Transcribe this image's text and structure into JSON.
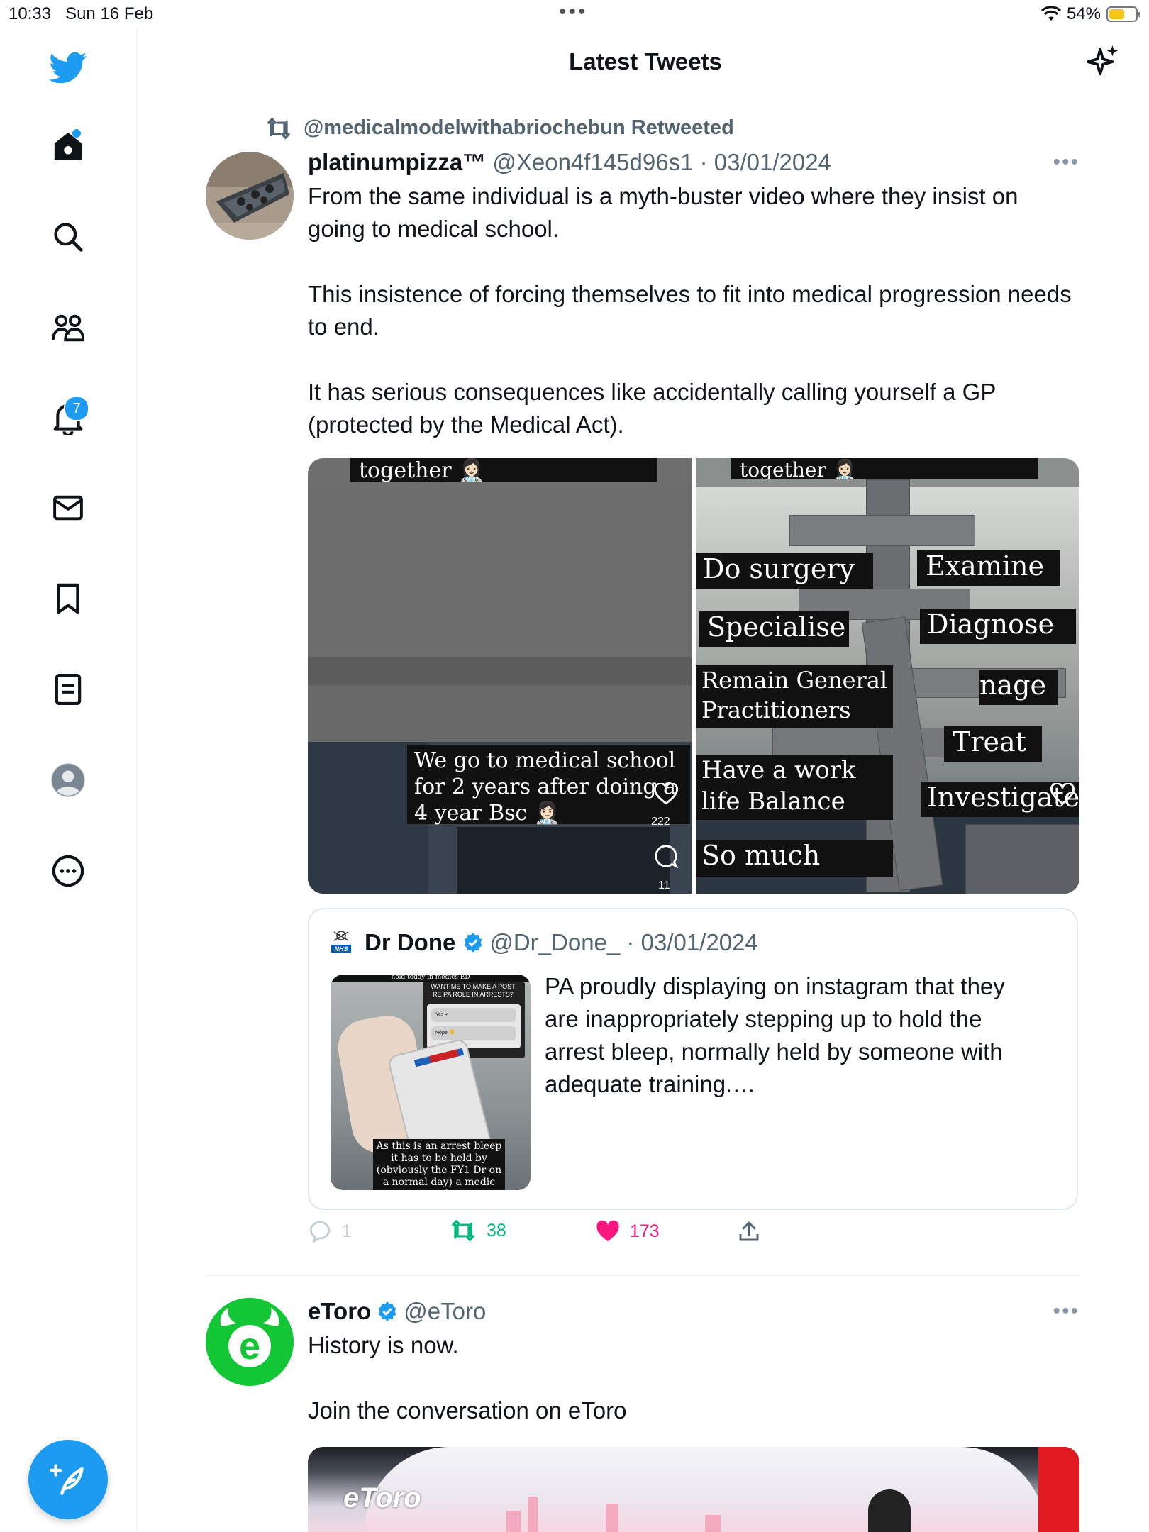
{
  "status_bar": {
    "time": "10:33",
    "date": "Sun 16 Feb",
    "battery": "54%",
    "battery_level": 0.54
  },
  "header": {
    "title": "Latest Tweets"
  },
  "sidebar": {
    "notifications_count": "7"
  },
  "tweets": [
    {
      "retweeted_by": "@medicalmodelwithabriochebun Retweeted",
      "name": "platinumpizza™",
      "handle_date": "@Xeon4f145d96s1 · 03/01/2024",
      "text": "From the same individual is a myth-buster video where they insist on going to medical school.\n\nThis insistence of forcing themselves to fit into medical progression needs to end.\n\nIt has serious consequences like accidentally calling yourself a GP (protected by the Medical Act).",
      "media": {
        "left": {
          "top_caption": "together 👩🏻‍⚕️",
          "caption": "We go to medical school for 2 years after doing a 4 year Bsc 👩🏻‍⚕️",
          "likes": "222",
          "comments": "11"
        },
        "right": {
          "top_caption": "together 👩🏻‍⚕️",
          "labels_left": [
            "Do surgery",
            "Specialise",
            "Remain General Practitioners",
            "Have a work life Balance",
            "So much more"
          ],
          "labels_right": [
            "Examine",
            "Diagnose",
            "nage",
            "Treat",
            "Investigate"
          ],
          "likes": "222"
        }
      },
      "quote": {
        "name": "Dr Done",
        "handle_date": "@Dr_Done_ · 03/01/2024",
        "text": "PA proudly displaying on instagram that they are inappropriately stepping up to hold the arrest bleep, normally held by someone with adequate training.…",
        "thumb_poll_question": "WANT ME TO MAKE A POST RE PA ROLE IN ARRESTS?",
        "thumb_poll_yes": "Yes ✓",
        "thumb_poll_no": "Nope 👎",
        "thumb_caption": "As this is an arrest bleep it has to be held by (obviously the FY1 Dr on a normal day) a medic and",
        "thumb_top_text": "hold today in medics ED"
      },
      "actions": {
        "replies": "1",
        "retweets": "38",
        "likes": "173"
      }
    },
    {
      "name": "eToro",
      "handle": "@eToro",
      "text": "History is now.\n\nJoin the conversation on eToro",
      "media_logo": "eToro"
    }
  ],
  "colors": {
    "accent": "#1d9bf0",
    "retweet_green": "#00ba7c",
    "like_pink": "#f91880",
    "secondary_text": "#536471",
    "etoro_green": "#13c636"
  }
}
